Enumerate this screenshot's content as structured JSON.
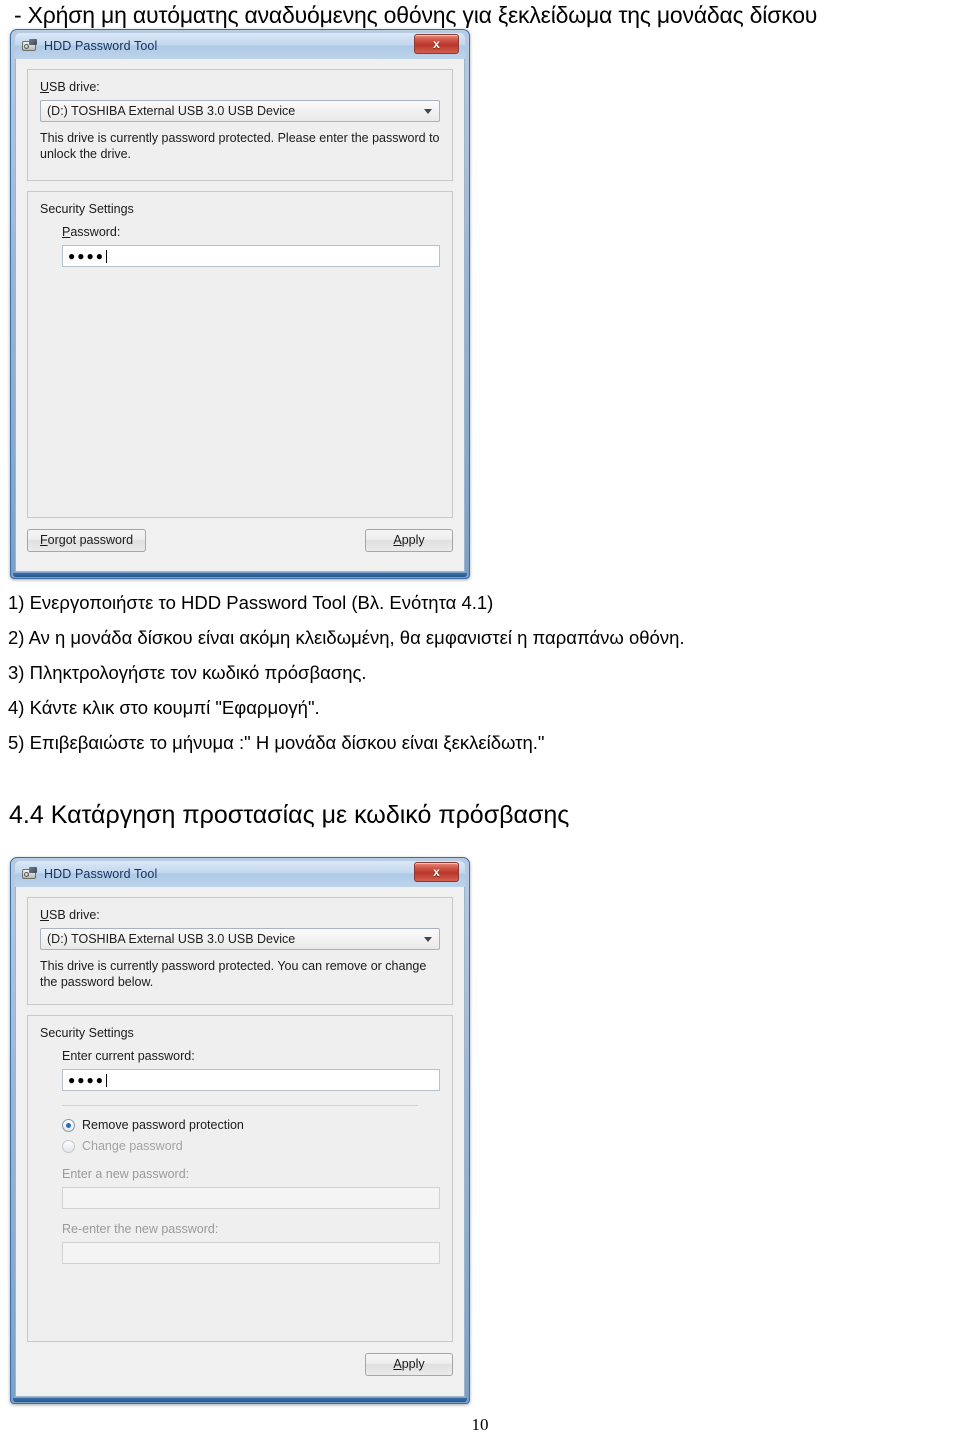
{
  "document": {
    "heading": "- Χρήση μη αυτόματης αναδυόμενης οθόνης για ξεκλείδωμα της μονάδας δίσκου",
    "section_title": "4.4 Κατάργηση προστασίας με κωδικό πρόσβασης",
    "page_number": "10",
    "steps": [
      "1) Ενεργοποιήστε το HDD Password Tool (Βλ. Ενότητα 4.1)",
      "2) Αν η μονάδα δίσκου είναι ακόμη κλειδωμένη, θα εμφανιστεί η παραπάνω οθόνη.",
      "3) Πληκτρολογήστε τον κωδικό πρόσβασης.",
      "4) Κάντε κλικ στο κουμπί \"Εφαρμογή\".",
      "5) Επιβεβαιώστε το μήνυμα :\" Η μονάδα δίσκου είναι ξεκλείδωτη.\""
    ]
  },
  "dialog_unlock": {
    "title": "HDD Password Tool",
    "close_label": "x",
    "drive_group": {
      "label": "USB drive:",
      "selected_option": "(D:) TOSHIBA External USB 3.0 USB Device",
      "options": [
        "(D:) TOSHIBA External USB 3.0 USB Device"
      ],
      "hint": "This drive is currently password protected.  Please enter the password to unlock the drive."
    },
    "security_group": {
      "label": "Security Settings",
      "password_label": "Password:",
      "password_value": "●●●●",
      "password_placeholder": ""
    },
    "buttons": {
      "forgot": "Forgot password",
      "apply": "Apply"
    }
  },
  "dialog_remove": {
    "title": "HDD Password Tool",
    "close_label": "x",
    "drive_group": {
      "label": "USB drive:",
      "selected_option": "(D:) TOSHIBA External USB 3.0 USB Device",
      "options": [
        "(D:) TOSHIBA External USB 3.0 USB Device"
      ],
      "hint": "This drive is currently password protected. You can remove or change the password below."
    },
    "security_group": {
      "label": "Security Settings",
      "current_password_label": "Enter current password:",
      "current_password_value": "●●●●",
      "radio_remove": "Remove password protection",
      "radio_change": "Change password",
      "selected_radio": "Remove password protection",
      "new_password_label": "Enter a new password:",
      "new_password_value": "",
      "reenter_password_label": "Re-enter the new password:",
      "reenter_password_value": ""
    },
    "buttons": {
      "apply": "Apply"
    }
  },
  "theme": {
    "title_text": "#15325c",
    "close_red": "#b8362a",
    "radio_accent": "#2a6fb5",
    "window_frame": "#3a6ea5"
  }
}
